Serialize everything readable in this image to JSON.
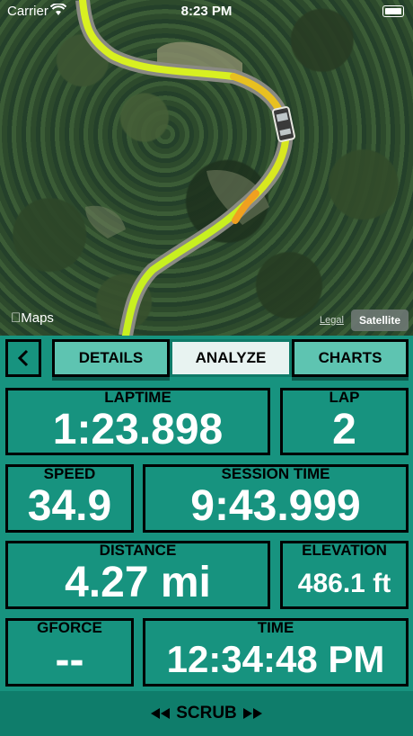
{
  "status_bar": {
    "carrier": "Carrier",
    "time": "8:23 PM"
  },
  "map": {
    "maps_logo": "Maps",
    "legal": "Legal",
    "satellite_button": "Satellite"
  },
  "tabs": [
    {
      "label": "DETAILS",
      "active": false
    },
    {
      "label": "ANALYZE",
      "active": true
    },
    {
      "label": "CHARTS",
      "active": false
    }
  ],
  "stats": {
    "laptime": {
      "label": "LAPTIME",
      "value": "1:23.898"
    },
    "lap": {
      "label": "LAP",
      "value": "2"
    },
    "speed": {
      "label": "SPEED",
      "value": "34.9"
    },
    "session_time": {
      "label": "SESSION TIME",
      "value": "9:43.999"
    },
    "distance": {
      "label": "DISTANCE",
      "value": "4.27 mi"
    },
    "elevation": {
      "label": "ELEVATION",
      "value": "486.1 ft"
    },
    "gforce": {
      "label": "GFORCE",
      "value": "--"
    },
    "time": {
      "label": "TIME",
      "value": "12:34:48 PM"
    }
  },
  "scrub": {
    "label": "SCRUB",
    "left_icon": "rewind-icon",
    "right_icon": "fast-forward-icon"
  },
  "colors": {
    "panel": "#17937f",
    "tab_inactive": "#5ec4b1",
    "tab_active": "#e8f3f1",
    "route_yellow": "#d8f021",
    "route_orange": "#f0b020"
  }
}
